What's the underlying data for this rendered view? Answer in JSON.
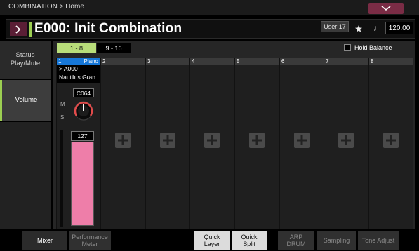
{
  "header": {
    "breadcrumb": "COMBINATION > Home"
  },
  "title_bar": {
    "title": "E000: Init Combination",
    "bank": "User 17",
    "tempo": "120.00",
    "accent_color": "#9ccf52"
  },
  "left_tabs": [
    {
      "label": "Status Play/Mute",
      "line1": "Status",
      "line2": "Play/Mute",
      "active": false
    },
    {
      "label": "Volume",
      "active": true
    }
  ],
  "main": {
    "range_tabs": [
      "1 - 8",
      "9 - 16"
    ],
    "selected_range": "1 - 8",
    "hold_balance_label": "Hold Balance",
    "hold_balance_checked": false
  },
  "channels": [
    {
      "number": "1",
      "instrument": "Piano",
      "program_number": "> A000",
      "program_name": "Nautilus Gran",
      "pan": "C064",
      "mute_label": "M",
      "solo_label": "S",
      "volume": "127",
      "volume_level": 1.0,
      "fader_color": "#ee7ea9",
      "header_color": "#1677d8"
    },
    {
      "number": "2"
    },
    {
      "number": "3"
    },
    {
      "number": "4"
    },
    {
      "number": "5"
    },
    {
      "number": "6"
    },
    {
      "number": "7"
    },
    {
      "number": "8"
    }
  ],
  "bottom_tabs": [
    {
      "label": "Mixer",
      "selected": true
    },
    {
      "line1": "Performance",
      "line2": "Meter"
    },
    {
      "line1": "Quick",
      "line2": "Layer"
    },
    {
      "line1": "Quick",
      "line2": "Split"
    },
    {
      "line1": "ARP",
      "line2": "DRUM"
    },
    {
      "label": "Sampling"
    },
    {
      "label": "Tone Adjust"
    }
  ],
  "icons": {
    "menu": "chevron-down-icon",
    "nav": "chevron-right-icon",
    "favorite": "star-icon",
    "tempo": "note-icon",
    "add": "plus-icon"
  }
}
